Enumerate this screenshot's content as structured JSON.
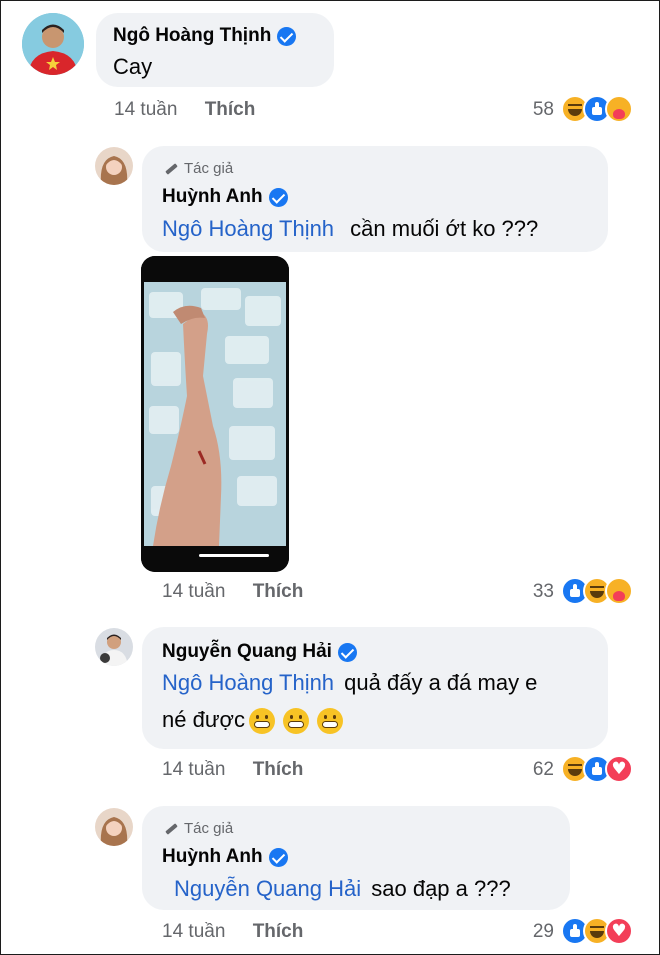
{
  "comments": [
    {
      "name": "Ngô Hoàng Thịnh",
      "text": "Cay",
      "time": "14 tuần",
      "like_label": "Thích",
      "reaction_count": "58",
      "reactions": [
        "haha",
        "like",
        "care"
      ]
    },
    {
      "author_badge": "Tác giả",
      "name": "Huỳnh Anh",
      "mention": "Ngô Hoàng Thịnh",
      "text": "cần muối ớt ko ???",
      "time": "14 tuần",
      "like_label": "Thích",
      "reaction_count": "33",
      "reactions": [
        "like",
        "haha",
        "care"
      ]
    },
    {
      "name": "Nguyễn Quang Hải",
      "mention": "Ngô Hoàng Thịnh",
      "text_line1": "quả đấy a đá may e",
      "text_line2": "né được",
      "emoji": "grimacing-face",
      "time": "14 tuần",
      "like_label": "Thích",
      "reaction_count": "62",
      "reactions": [
        "haha",
        "like",
        "love"
      ]
    },
    {
      "author_badge": "Tác giả",
      "name": "Huỳnh Anh",
      "mention": "Nguyễn Quang Hải",
      "text": "sao đạp a ???",
      "time": "14 tuần",
      "like_label": "Thích",
      "reaction_count": "29",
      "reactions": [
        "like",
        "haha",
        "love"
      ]
    }
  ],
  "colors": {
    "bubble": "#f0f2f5",
    "mention": "#2563c9",
    "meta": "#65676b",
    "verified": "#1877f2"
  }
}
